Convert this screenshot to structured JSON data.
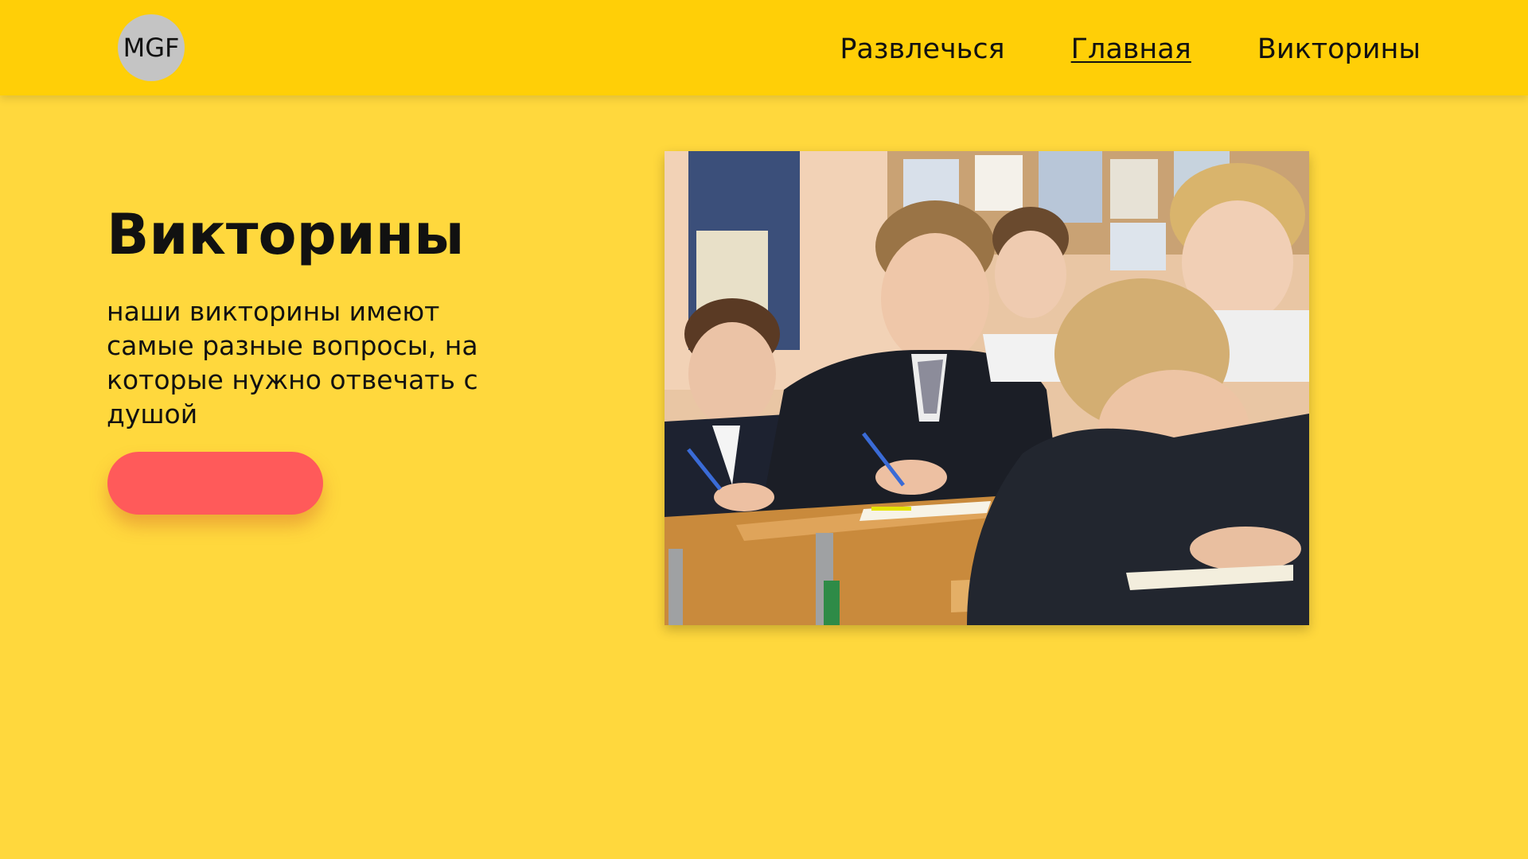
{
  "header": {
    "logo_text": "MGF",
    "nav": [
      {
        "label": "Развлечься",
        "active": false
      },
      {
        "label": "Главная",
        "active": true
      },
      {
        "label": "Викторины",
        "active": false
      }
    ]
  },
  "hero": {
    "title": "Викторины",
    "description": "наши викторины имеют самые разные вопросы, на которые нужно отвечать с душой",
    "button_label": ""
  },
  "image": {
    "subject": "schoolchildren-writing-at-desks-photo"
  },
  "colors": {
    "background": "#FFD83D",
    "header": "#FFCF07",
    "button": "#FF5A5A",
    "logo_circle": "#C4C4C4"
  }
}
